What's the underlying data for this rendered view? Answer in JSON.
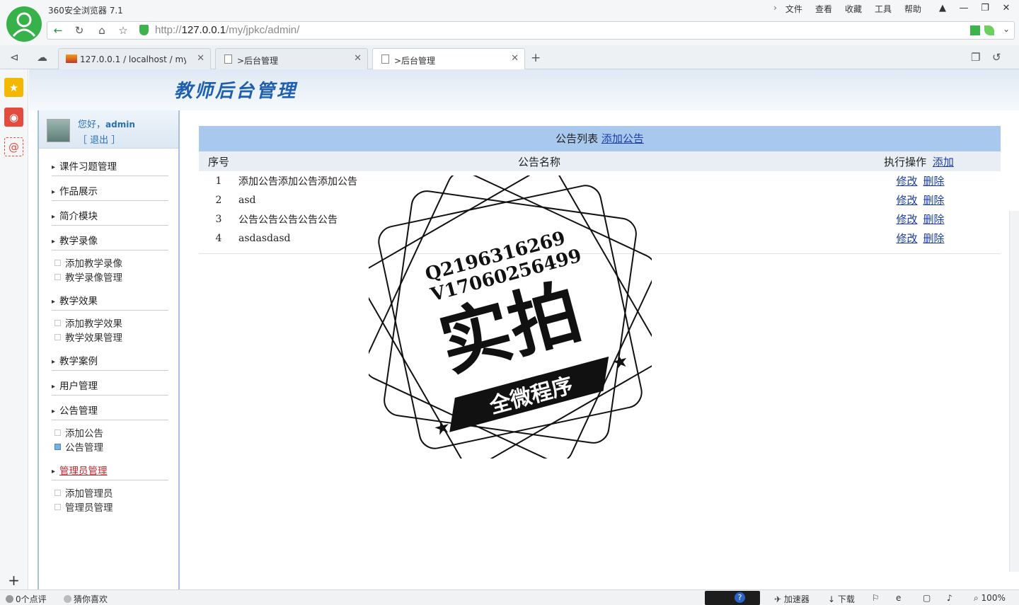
{
  "browser": {
    "app_title": "360安全浏览器 7.1",
    "menus": [
      "文件",
      "查看",
      "收藏",
      "工具",
      "帮助"
    ],
    "url_scheme": "http://",
    "url_host": "127.0.0.1",
    "url_path": "/my/jpkc/admin/",
    "tabs": [
      {
        "label": "127.0.0.1 / localhost / my_ke",
        "active": false
      },
      {
        "label": ">后台管理",
        "active": false
      },
      {
        "label": ">后台管理",
        "active": true
      }
    ]
  },
  "banner": {
    "title": "教师后台管理"
  },
  "user": {
    "greeting": "您好，",
    "name": "admin",
    "logout": "［ 退出 ］"
  },
  "sidebar": {
    "m1": "课件习题管理",
    "m2": "作品展示",
    "m3": "简介模块",
    "m4": "教学录像",
    "m4_s1": "添加教学录像",
    "m4_s2": "教学录像管理",
    "m5": "教学效果",
    "m5_s1": "添加教学效果",
    "m5_s2": "教学效果管理",
    "m6": "教学案例",
    "m7": "用户管理",
    "m8": "公告管理",
    "m8_s1": "添加公告",
    "m8_s2": "公告管理",
    "m9": "管理员管理",
    "m9_s1": "添加管理员",
    "m9_s2": "管理员管理"
  },
  "table": {
    "caption": "公告列表",
    "caption_link": "添加公告",
    "headers": {
      "num": "序号",
      "name": "公告名称",
      "ops": "执行操作",
      "add": "添加"
    },
    "edit_label": "修改",
    "delete_label": "删除",
    "rows": [
      {
        "num": "1",
        "name": "添加公告添加公告添加公告"
      },
      {
        "num": "2",
        "name": "asd"
      },
      {
        "num": "3",
        "name": "公告公告公告公告公告"
      },
      {
        "num": "4",
        "name": "asdasdasd"
      }
    ]
  },
  "watermark": {
    "line1": "Q2196316269",
    "line2": "V17060256499",
    "big": "实拍",
    "ribbon": "全微程序"
  },
  "status": {
    "left1": "0个点评",
    "left2": "猜你喜欢",
    "accel": "加速器",
    "download": "下载",
    "zoom": "100%"
  },
  "colors": {
    "accent": "#1a3da6",
    "caption_bg": "#a9c8ee",
    "active_menu": "#c1272d",
    "brand_green": "#37b24a"
  }
}
